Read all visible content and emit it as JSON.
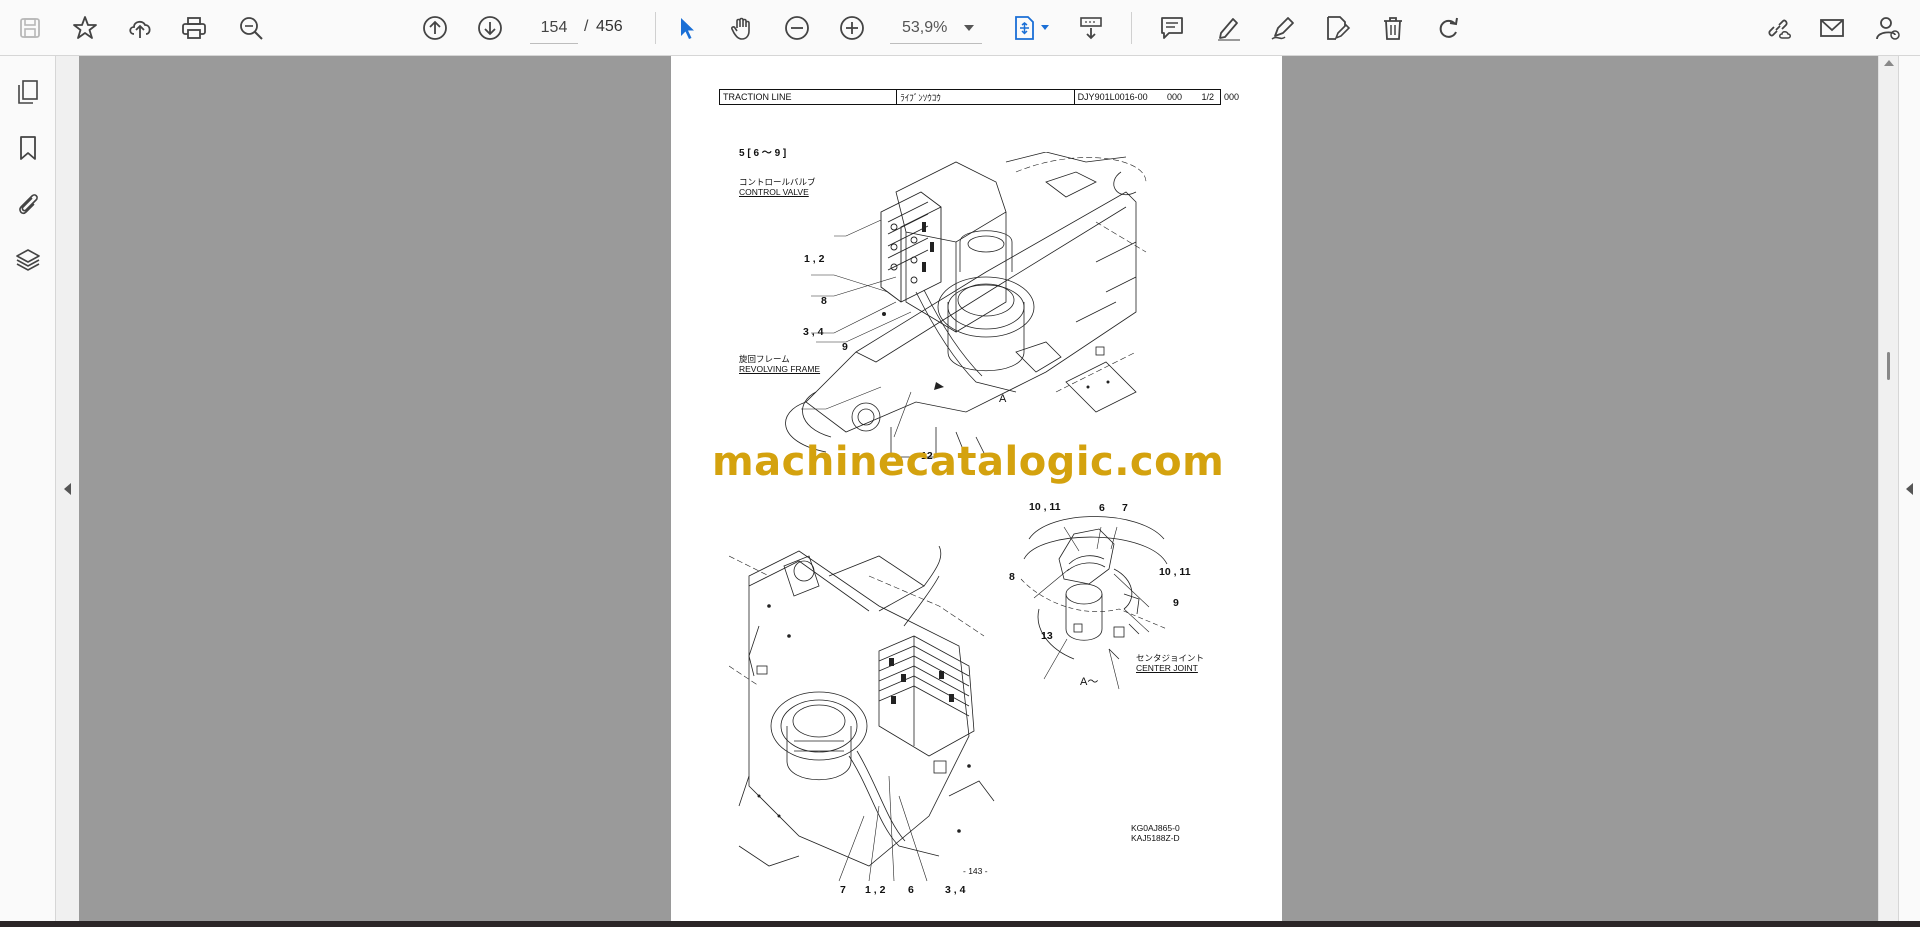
{
  "toolbar": {
    "current_page": "154",
    "page_separator": "/",
    "total_pages": "456",
    "zoom": "53,9%"
  },
  "document": {
    "header": {
      "title": "TRACTION LINE",
      "title_jp": "ﾗｲﾌﾞﾝｿｳｺｳ",
      "code": "DJY901L0016-00",
      "rev": "000",
      "sheet": "1/2",
      "extra": "000"
    },
    "section_ref": "5 [ 6 ～ 9 ]",
    "labels": {
      "control_valve_jp": "コントロールバルブ",
      "control_valve": "CONTROL VALVE",
      "revolving_frame_jp": "旋回フレーム",
      "revolving_frame": "REVOLVING FRAME",
      "center_joint_jp": "センタジョイント",
      "center_joint": "CENTER JOINT",
      "view_a_marker": "A",
      "view_a": "A～"
    },
    "callouts": {
      "top_1_2": "1 , 2",
      "top_8": "8",
      "top_3_4": "3 , 4",
      "top_9": "9",
      "top_12": "12",
      "detail_10_11_top": "10 , 11",
      "detail_6": "6",
      "detail_7": "7",
      "detail_8": "8",
      "detail_10_11_right": "10 , 11",
      "detail_9": "9",
      "detail_13": "13",
      "bottom_7": "7",
      "bottom_1_2": "1 , 2",
      "bottom_6": "6",
      "bottom_3_4": "3 , 4"
    },
    "drawing_refs": {
      "ref1": "KG0AJ865-0",
      "ref2": "KAJ5188Z-D"
    },
    "page_number": "- 143 -",
    "watermark": "machinecatalogic.com"
  },
  "colors": {
    "watermark": "#d4a20e",
    "select_tool": "#1a6fd6",
    "viewer_gray": "#9a9a9a"
  }
}
